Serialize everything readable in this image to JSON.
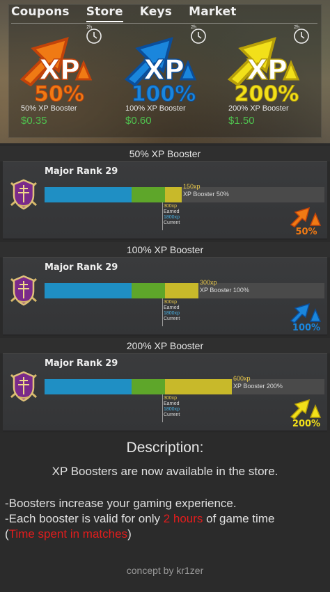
{
  "tabs": [
    "Coupons",
    "Store",
    "Keys",
    "Market"
  ],
  "active_tab": "Store",
  "store_items": [
    {
      "xp": "XP",
      "percent": "50%",
      "name": "50% XP Booster",
      "price": "$0.35",
      "timer": "2h",
      "color": "#f07a14",
      "color_dark": "#c2430a"
    },
    {
      "xp": "XP",
      "percent": "100%",
      "name": "100% XP Booster",
      "price": "$0.60",
      "timer": "2h",
      "color": "#1a86dc",
      "color_dark": "#0b4e9a"
    },
    {
      "xp": "XP",
      "percent": "200%",
      "name": "200% XP Booster",
      "price": "$1.50",
      "timer": "2h",
      "color": "#f2e01a",
      "color_dark": "#b8a00a"
    }
  ],
  "sections": [
    {
      "title": "50% XP Booster",
      "rank": "Major Rank 29",
      "bonus": "150xp",
      "bonus_label": "XP Booster 50%",
      "earned": "300xp",
      "earned_label": "Earned",
      "current": "1800xp",
      "current_label": "Current",
      "badge_percent": "50%",
      "badge_xp": "XP",
      "color": "#f07a14",
      "color_dark": "#c2430a",
      "progress": {
        "blue": 0.31,
        "green": 0.12,
        "yellow": 0.06
      }
    },
    {
      "title": "100% XP Booster",
      "rank": "Major Rank 29",
      "bonus": "300xp",
      "bonus_label": "XP Booster 100%",
      "earned": "300xp",
      "earned_label": "Earned",
      "current": "1800xp",
      "current_label": "Current",
      "badge_percent": "100%",
      "badge_xp": "XP",
      "color": "#1a86dc",
      "color_dark": "#0b4e9a",
      "progress": {
        "blue": 0.31,
        "green": 0.12,
        "yellow": 0.12
      }
    },
    {
      "title": "200% XP Booster",
      "rank": "Major Rank 29",
      "bonus": "600xp",
      "bonus_label": "XP Booster 200%",
      "earned": "300xp",
      "earned_label": "Earned",
      "current": "1800xp",
      "current_label": "Current",
      "badge_percent": "200%",
      "badge_xp": "XP",
      "color": "#f2e01a",
      "color_dark": "#b8a00a",
      "progress": {
        "blue": 0.31,
        "green": 0.12,
        "yellow": 0.24
      }
    }
  ],
  "description": {
    "title": "Description:",
    "line1": "XP Boosters are now available in the store.",
    "bullet1": "-Boosters increase your gaming experience.",
    "bullet2_pre": "-Each booster is valid for only ",
    "bullet2_highlight": "2 hours",
    "bullet2_post": " of game time",
    "bullet3_open": "(",
    "bullet3_highlight": "Time spent in matches",
    "bullet3_close": ")"
  },
  "credit": "concept by kr1zer"
}
